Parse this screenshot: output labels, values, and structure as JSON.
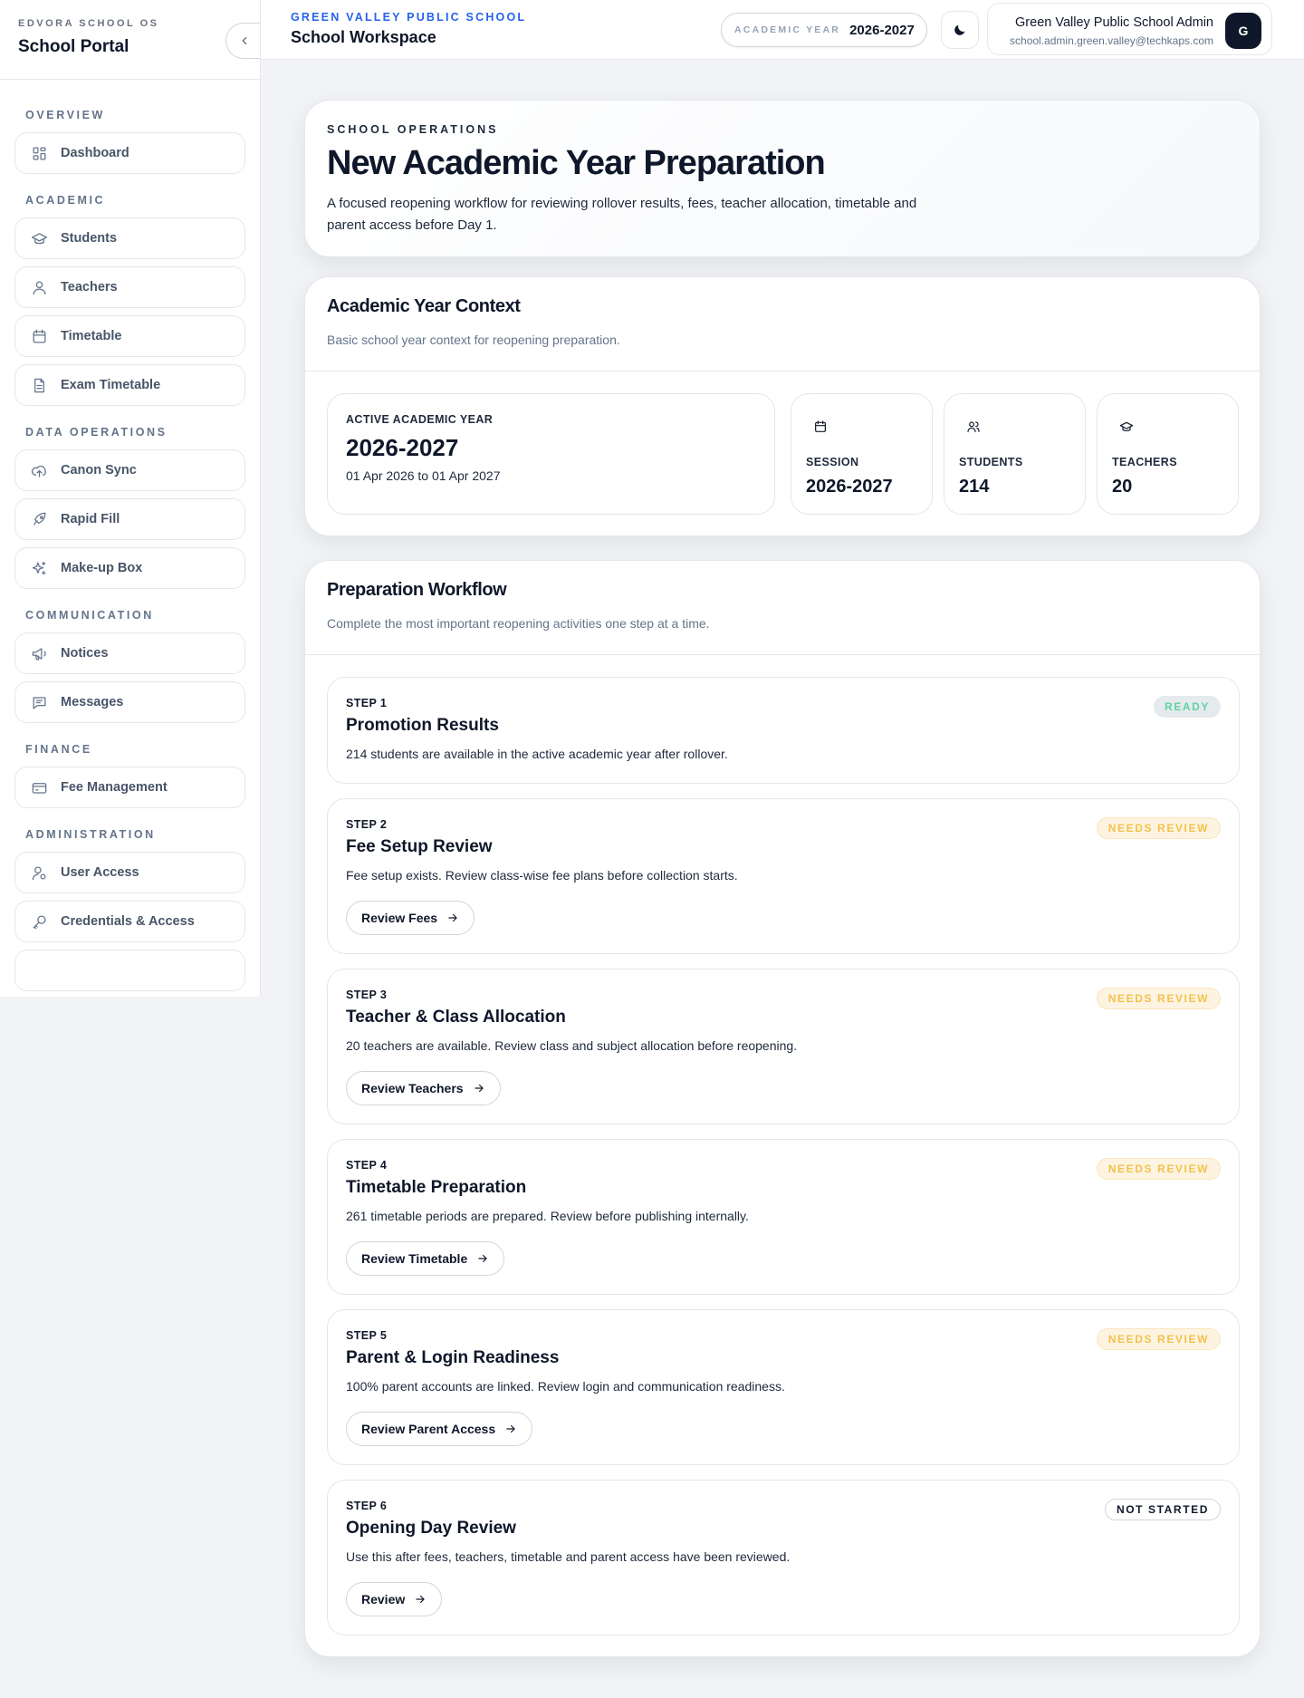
{
  "sidebar": {
    "kicker": "EDVORA SCHOOL OS",
    "title": "School Portal",
    "sections": [
      {
        "title": "OVERVIEW",
        "items": [
          {
            "label": "Dashboard",
            "icon": "dashboard-icon"
          }
        ]
      },
      {
        "title": "ACADEMIC",
        "items": [
          {
            "label": "Students",
            "icon": "graduation-cap-icon"
          },
          {
            "label": "Teachers",
            "icon": "user-icon"
          },
          {
            "label": "Timetable",
            "icon": "calendar-icon"
          },
          {
            "label": "Exam Timetable",
            "icon": "document-icon"
          }
        ]
      },
      {
        "title": "DATA OPERATIONS",
        "items": [
          {
            "label": "Canon Sync",
            "icon": "cloud-upload-icon"
          },
          {
            "label": "Rapid Fill",
            "icon": "rocket-icon"
          },
          {
            "label": "Make-up Box",
            "icon": "sparkles-icon"
          }
        ]
      },
      {
        "title": "COMMUNICATION",
        "items": [
          {
            "label": "Notices",
            "icon": "megaphone-icon"
          },
          {
            "label": "Messages",
            "icon": "message-icon"
          }
        ]
      },
      {
        "title": "FINANCE",
        "items": [
          {
            "label": "Fee Management",
            "icon": "credit-card-icon"
          }
        ]
      },
      {
        "title": "ADMINISTRATION",
        "items": [
          {
            "label": "User Access",
            "icon": "user-settings-icon"
          },
          {
            "label": "Credentials & Access",
            "icon": "key-icon"
          }
        ]
      }
    ]
  },
  "topbar": {
    "school": "GREEN VALLEY PUBLIC SCHOOL",
    "workspace": "School Workspace",
    "year_label": "ACADEMIC YEAR",
    "year_value": "2026-2027",
    "user_name": "Green Valley Public School Admin",
    "user_email": "school.admin.green.valley@techkaps.com",
    "avatar_initial": "G"
  },
  "hero": {
    "kicker": "SCHOOL OPERATIONS",
    "title": "New Academic Year Preparation",
    "description": "A focused reopening workflow for reviewing rollover results, fees, teacher allocation, timetable and parent access before Day 1."
  },
  "context": {
    "title": "Academic Year Context",
    "subtitle": "Basic school year context for reopening preparation.",
    "active_label": "ACTIVE ACADEMIC YEAR",
    "active_value": "2026-2027",
    "active_range": "01 Apr 2026 to 01 Apr 2027",
    "stats": [
      {
        "label": "SESSION",
        "value": "2026-2027",
        "icon": "calendar-icon"
      },
      {
        "label": "STUDENTS",
        "value": "214",
        "icon": "users-icon"
      },
      {
        "label": "TEACHERS",
        "value": "20",
        "icon": "graduation-cap-icon"
      }
    ]
  },
  "workflow": {
    "title": "Preparation Workflow",
    "subtitle": "Complete the most important reopening activities one step at a time.",
    "steps": [
      {
        "step": "STEP 1",
        "title": "Promotion Results",
        "desc": "214 students are available in the active academic year after rollover.",
        "status": "READY",
        "button": ""
      },
      {
        "step": "STEP 2",
        "title": "Fee Setup Review",
        "desc": "Fee setup exists. Review class-wise fee plans before collection starts.",
        "status": "NEEDS REVIEW",
        "button": "Review Fees"
      },
      {
        "step": "STEP 3",
        "title": "Teacher & Class Allocation",
        "desc": "20 teachers are available. Review class and subject allocation before reopening.",
        "status": "NEEDS REVIEW",
        "button": "Review Teachers"
      },
      {
        "step": "STEP 4",
        "title": "Timetable Preparation",
        "desc": "261 timetable periods are prepared. Review before publishing internally.",
        "status": "NEEDS REVIEW",
        "button": "Review Timetable"
      },
      {
        "step": "STEP 5",
        "title": "Parent & Login Readiness",
        "desc": "100% parent accounts are linked. Review login and communication readiness.",
        "status": "NEEDS REVIEW",
        "button": "Review Parent Access"
      },
      {
        "step": "STEP 6",
        "title": "Opening Day Review",
        "desc": "Use this after fees, teachers, timetable and parent access have been reviewed.",
        "status": "NOT STARTED",
        "button": "Review"
      }
    ]
  }
}
